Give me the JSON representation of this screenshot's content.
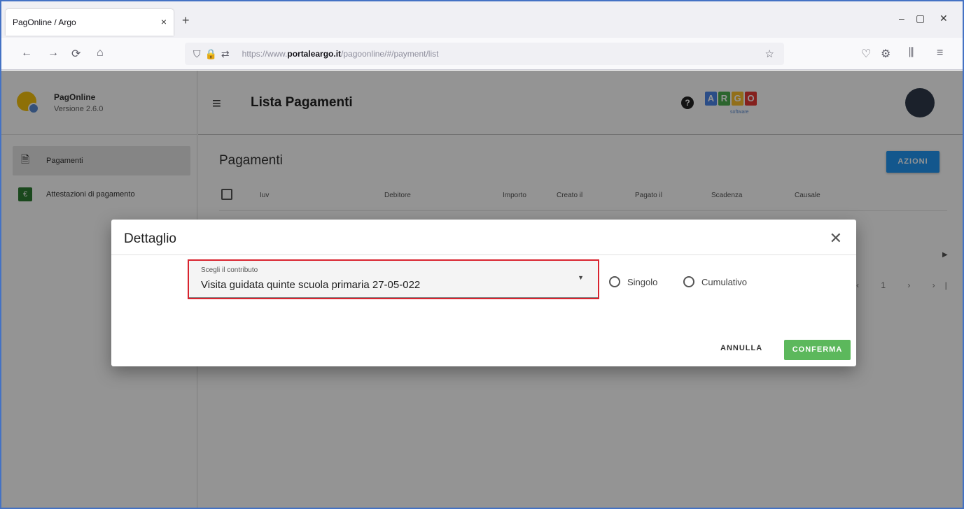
{
  "browser": {
    "tab_title": "PagOnline / Argo",
    "tab_close": "×",
    "new_tab": "+",
    "window_buttons": [
      "–",
      "▢",
      "✕"
    ],
    "nav": {
      "back": "←",
      "forward": "→",
      "reload": "⟳",
      "home": "⌂"
    },
    "url": {
      "prefix": "https://www.",
      "host": "portaleargo.it",
      "path": "/pagoonline/#/payment/list"
    },
    "toolbar_icons": [
      "pocket-icon",
      "extensions-icon",
      "library-icon",
      "menu-icon"
    ]
  },
  "sidebar": {
    "app_name": "PagOnline",
    "version": "Versione 2.6.0",
    "items": [
      {
        "label": "Pagamenti",
        "icon": "payments-doc-icon",
        "active": true
      },
      {
        "label": "Attestazioni di pagamento",
        "icon": "receipt-icon",
        "active": false
      }
    ]
  },
  "header": {
    "title": "Lista Pagamenti",
    "logo_letters": [
      "A",
      "R",
      "G",
      "O"
    ],
    "logo_colors": [
      "#4a86e8",
      "#4caf50",
      "#fbc02d",
      "#e53935"
    ],
    "logo_sub": "software"
  },
  "main": {
    "section_title": "Pagamenti",
    "actions_label": "AZIONI",
    "columns": [
      "Iuv",
      "Debitore",
      "Importo",
      "Creato il",
      "Pagato il",
      "Scadenza",
      "Causale"
    ],
    "pager": "‹ 1 › ›|"
  },
  "dialog": {
    "title": "Dettaglio",
    "select_label": "Scegli il contributo",
    "select_value": "Visita guidata quinte scuola primaria 27-05-022",
    "radio_options": [
      "Singolo",
      "Cumulativo"
    ],
    "cancel_label": "ANNULLA",
    "confirm_label": "CONFERMA",
    "highlight_color": "#d9232e",
    "confirm_color": "#5cb85c"
  }
}
